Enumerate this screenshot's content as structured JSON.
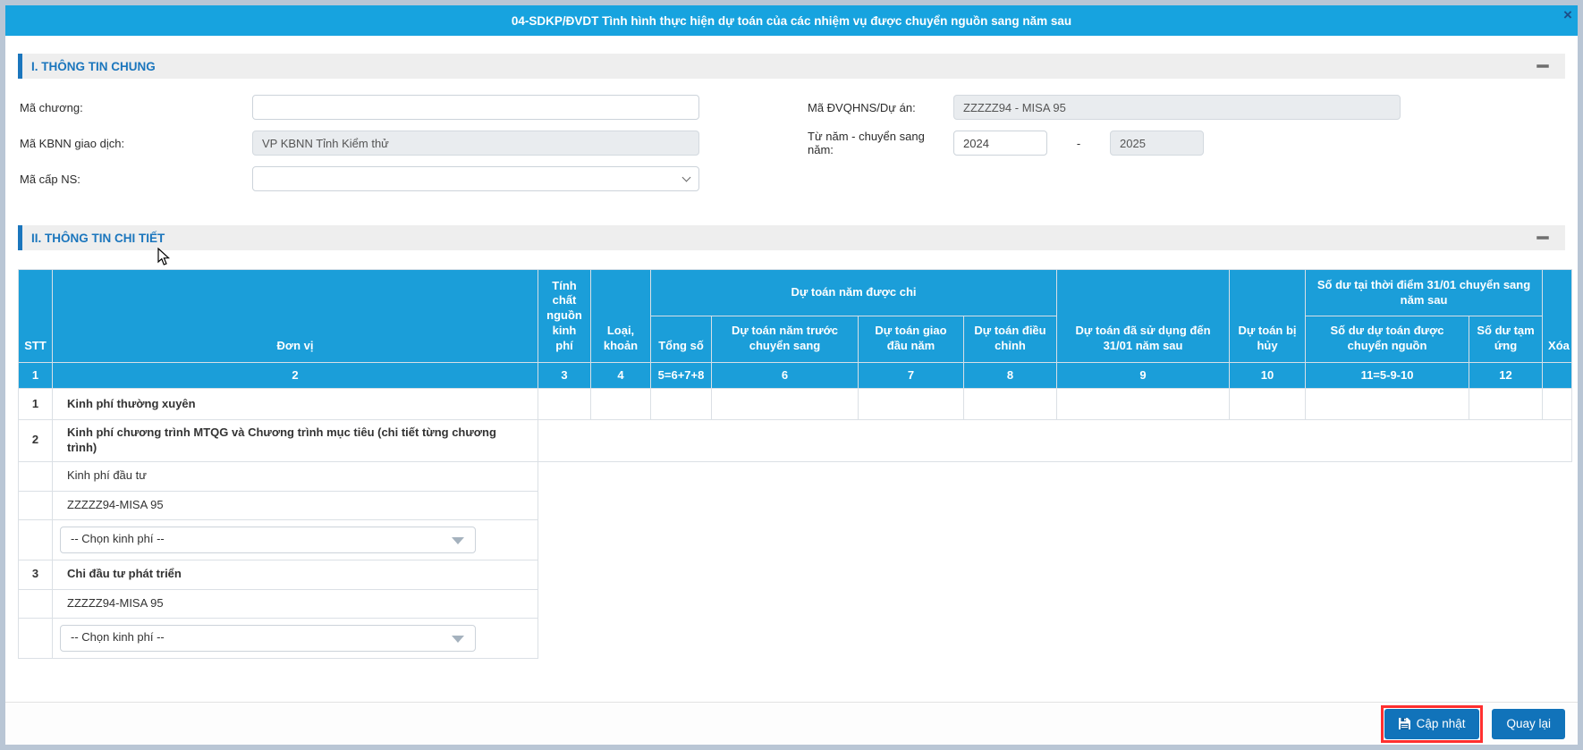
{
  "window": {
    "title": "04-SDKP/ĐVDT Tình hình thực hiện dự toán của các nhiệm vụ được chuyển nguồn sang năm sau",
    "close_glyph": "×"
  },
  "colors": {
    "titlebar_blue": "#17a3df",
    "table_header_blue": "#1b9ed9",
    "section_blue": "#1b76bd",
    "button_blue": "#1173ba",
    "highlight_red": "#ff2f2f",
    "disabled_field_bg": "#e9ecef"
  },
  "icons": {
    "close_icon": "x",
    "collapse_icon": "minus",
    "select_arrow_icon": "chevron-down",
    "combo_arrow_icon": "triangle-down",
    "save_icon": "floppy-disk",
    "pointer": "mouse-cursor"
  },
  "section_general": {
    "title": "I. THÔNG TIN CHUNG",
    "ma_chuong": {
      "label": "Mã chương:",
      "value": ""
    },
    "ma_dvqhns": {
      "label": "Mã ĐVQHNS/Dự án:",
      "value": "ZZZZZ94 - MISA 95"
    },
    "ma_kbnn": {
      "label": "Mã KBNN giao dịch:",
      "value": "VP KBNN Tỉnh Kiểm thử"
    },
    "tu_nam": {
      "label": "Từ năm - chuyển sang năm:",
      "from_value": "2024",
      "separator": "-",
      "to_value": "2025"
    },
    "ma_cap_ns": {
      "label": "Mã cấp NS:",
      "value": ""
    }
  },
  "section_detail": {
    "title": "II. THÔNG TIN CHI TIẾT",
    "table": {
      "headers": {
        "stt": "STT",
        "don_vi": "Đơn vị",
        "tinh_chat": "Tính chất nguồn kinh phí",
        "loai_khoan": "Loại, khoản",
        "du_toan_nam_duoc_chi": "Dự toán năm được chi",
        "tong_so": "Tổng số",
        "dt_nam_truoc": "Dự toán năm trước chuyển sang",
        "dt_giao_dau_nam": "Dự toán giao đầu năm",
        "dt_dieu_chinh": "Dự toán điều chỉnh",
        "dt_da_su_dung": "Dự toán đã sử dụng đến 31/01 năm sau",
        "dt_bi_huy": "Dự toán bị hủy",
        "so_du_group": "Số dư tại thời điểm 31/01 chuyển sang năm sau",
        "so_du_chuyen_nguon": "Số dư dự toán được chuyển nguồn",
        "so_du_tam_ung": "Số dư tạm ứng",
        "xoa": "Xóa"
      },
      "number_row": [
        "1",
        "2",
        "3",
        "4",
        "5=6+7+8",
        "6",
        "7",
        "8",
        "9",
        "10",
        "11=5-9-10",
        "12",
        ""
      ],
      "rows": [
        {
          "stt": "1",
          "don_vi": "Kinh phí thường xuyên"
        },
        {
          "stt": "2",
          "don_vi": "Kinh phí chương trình MTQG và Chương trình mục tiêu (chi tiết từng chương trình)"
        },
        {
          "stt": "",
          "don_vi": "Kinh phí đầu tư"
        },
        {
          "stt": "",
          "don_vi": "ZZZZZ94-MISA 95"
        },
        {
          "stt": "",
          "dropdown_placeholder": "-- Chọn kinh phí --"
        },
        {
          "stt": "3",
          "don_vi": "Chi đầu tư phát triển"
        },
        {
          "stt": "",
          "don_vi": "ZZZZZ94-MISA 95"
        },
        {
          "stt": "",
          "dropdown_placeholder": "-- Chọn kinh phí --"
        }
      ]
    }
  },
  "footer": {
    "update_label": "Cập nhật",
    "back_label": "Quay lại"
  }
}
